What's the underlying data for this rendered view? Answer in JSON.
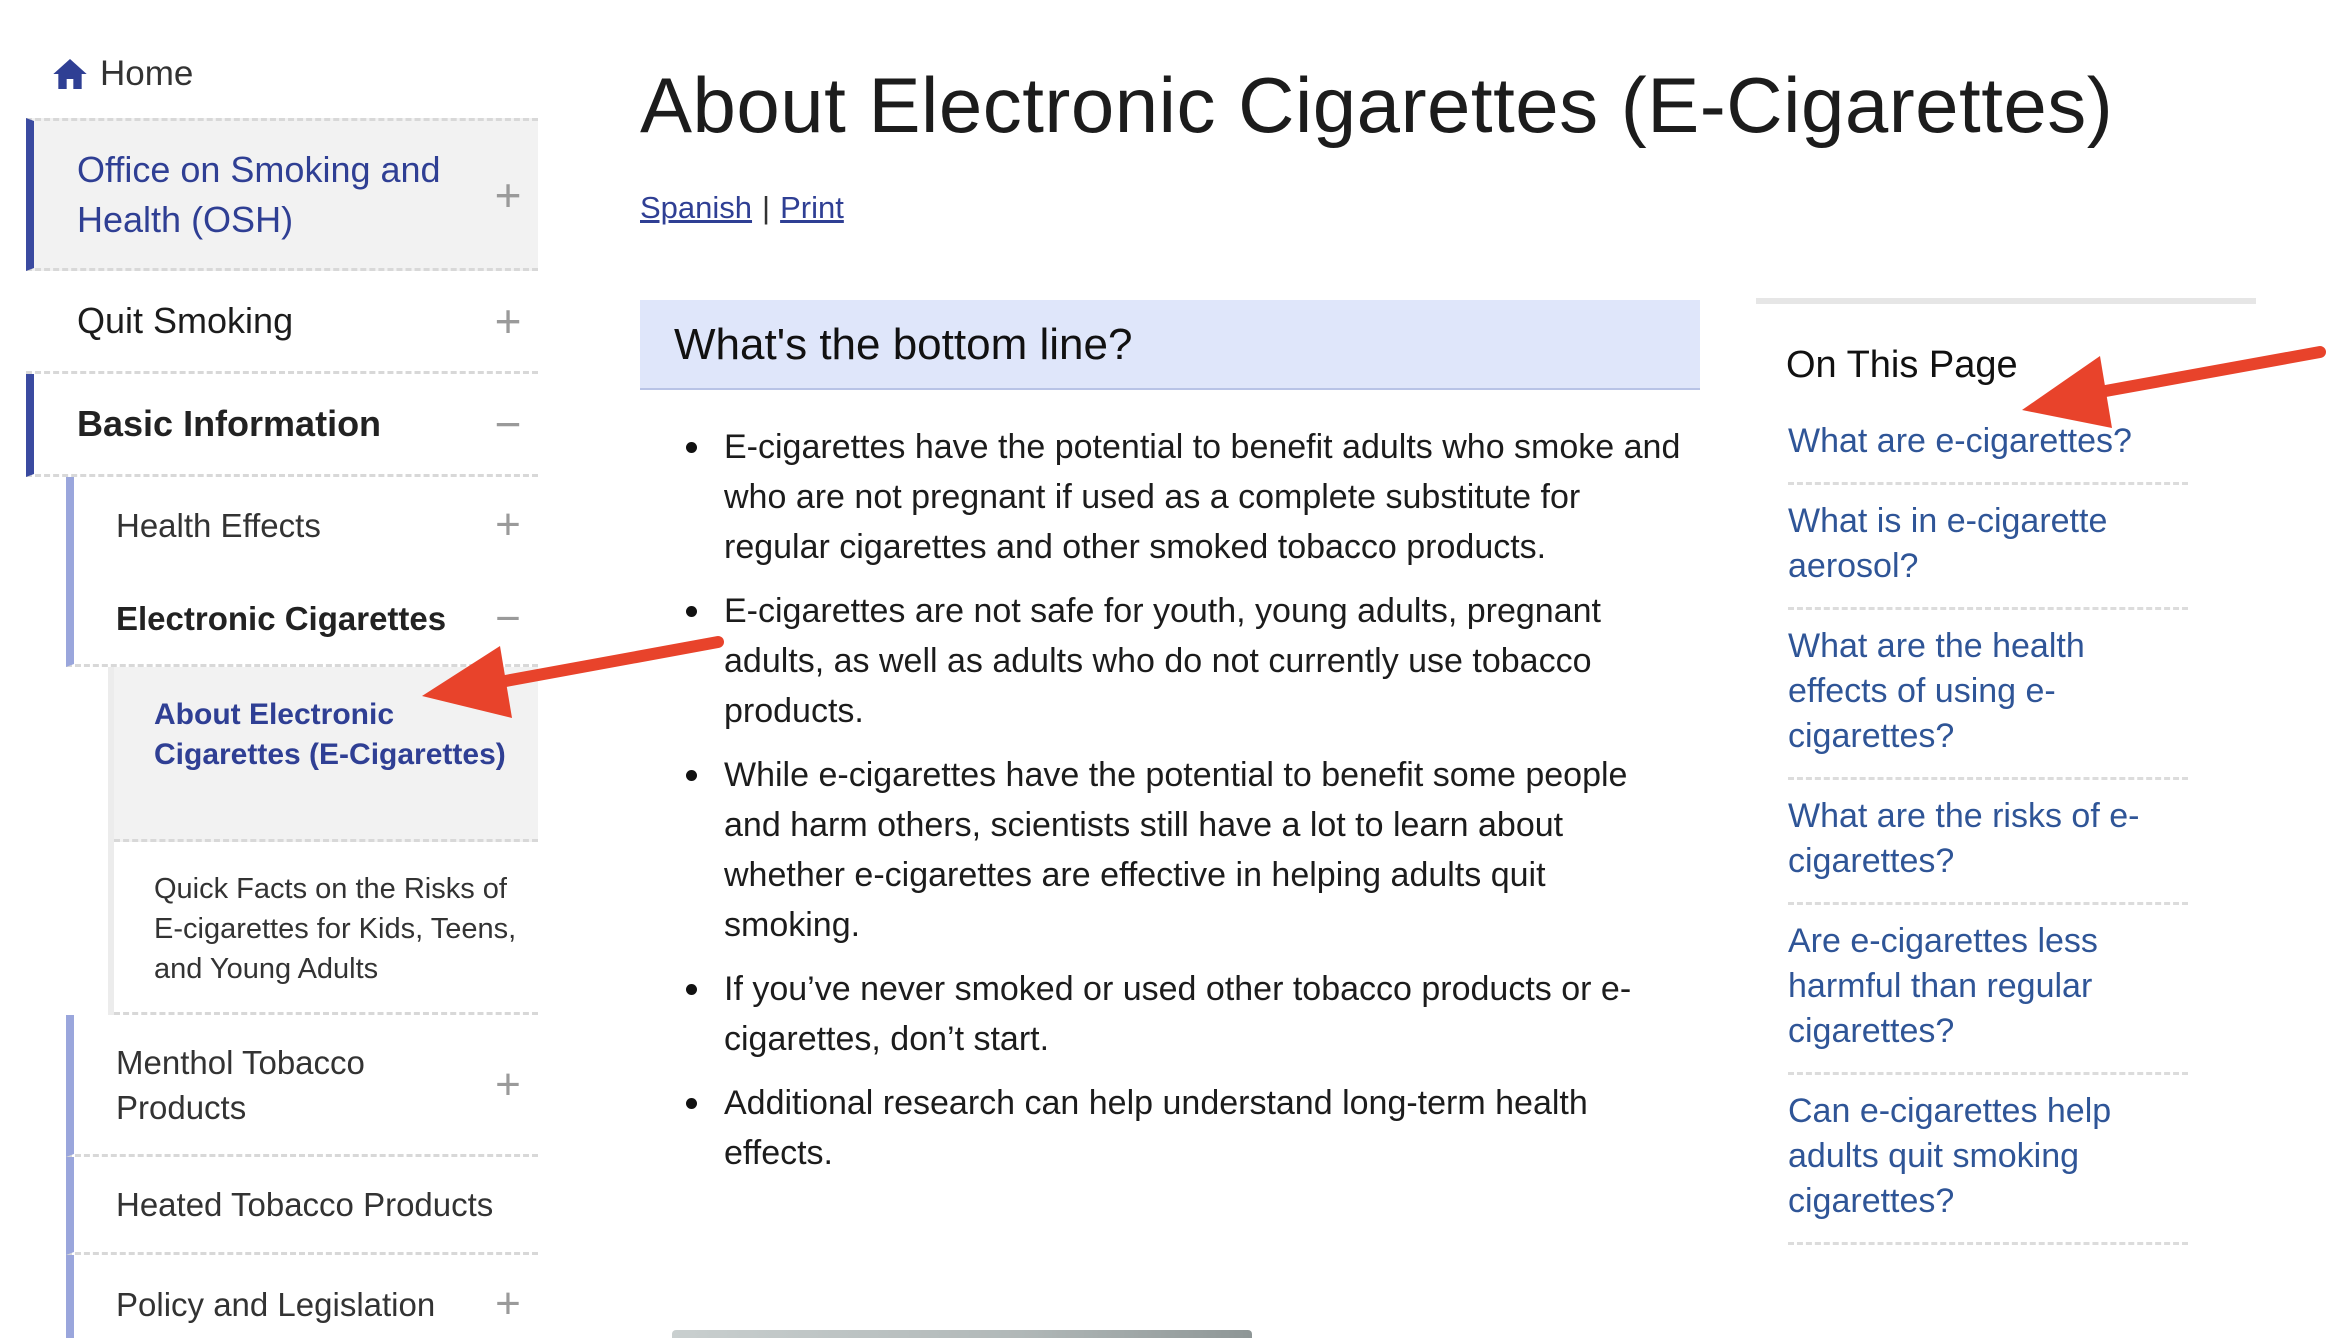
{
  "sidebar": {
    "home_label": "Home",
    "items": [
      {
        "label": "Office on Smoking and Health (OSH)",
        "toggle": "+"
      },
      {
        "label": "Quit Smoking",
        "toggle": "+"
      },
      {
        "label": "Basic Information",
        "toggle": "−"
      }
    ],
    "sub_items": [
      {
        "label": "Health Effects",
        "toggle": "+"
      },
      {
        "label": "Electronic Cigarettes",
        "toggle": "−"
      },
      {
        "label": "Menthol Tobacco Products",
        "toggle": "+"
      },
      {
        "label": "Heated Tobacco Products"
      },
      {
        "label": "Policy and Legislation",
        "toggle": "+"
      }
    ],
    "sub_sub_items": [
      {
        "label": "About Electronic Cigarettes (E-Cigarettes)"
      },
      {
        "label": "Quick Facts on the Risks of E-cigarettes for Kids, Teens, and Young Adults"
      }
    ]
  },
  "main": {
    "title": "About Electronic Cigarettes (E-Cigarettes)",
    "links": {
      "spanish": "Spanish",
      "separator": "|",
      "print": "Print"
    },
    "bottom_line_heading": "What's the bottom line?",
    "bullets": [
      "E-cigarettes have the potential to benefit adults who smoke and who are not pregnant if used as a complete substitute for regular cigarettes and other smoked tobacco products.",
      "E-cigarettes are not safe for youth, young adults, pregnant adults, as well as adults who do not currently use tobacco products.",
      "While e-cigarettes have the potential to benefit some people and harm others, scientists still have a lot to learn about whether e-cigarettes are effective in helping adults quit smoking.",
      "If you’ve never smoked or used other tobacco products or e-cigarettes, don’t start.",
      "Additional research can help understand long-term health effects."
    ]
  },
  "on_this_page": {
    "heading": "On This Page",
    "links": [
      "What are e-cigarettes?",
      "What is in e-cigarette aerosol?",
      "What are the health effects of using e-cigarettes?",
      "What are the risks of e-cigarettes?",
      "Are e-cigarettes less harmful than regular cigarettes?",
      "Can e-cigarettes help adults quit smoking cigarettes?"
    ]
  },
  "colors": {
    "nav_accent": "#3a4aa0",
    "nav_sub_accent": "#9aa6dc",
    "link": "#2f5597",
    "heading_box_bg": "#dfe6fa",
    "annotation_arrow": "#e8432b"
  },
  "icons": [
    "home-icon",
    "plus-icon",
    "minus-icon",
    "arrow-annotation"
  ]
}
